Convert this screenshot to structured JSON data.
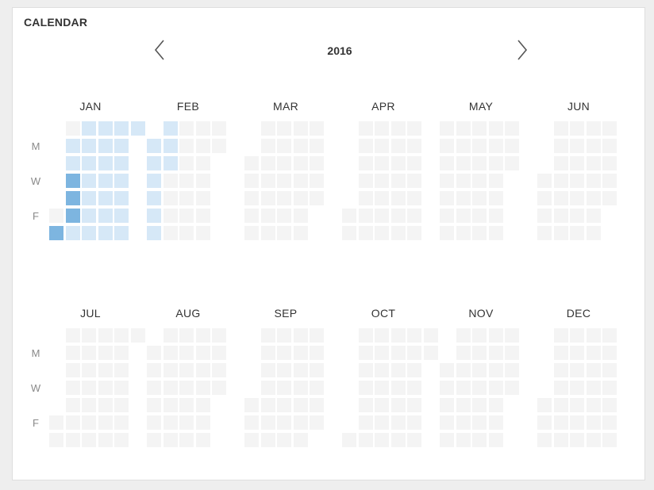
{
  "panel": {
    "title": "CALENDAR"
  },
  "navigation": {
    "year": "2016",
    "prev_icon": "chevron-left-icon",
    "next_icon": "chevron-right-icon"
  },
  "calendar": {
    "day_labels": [
      "M",
      "W",
      "F"
    ],
    "months": [
      "JAN",
      "FEB",
      "MAR",
      "APR",
      "MAY",
      "JUN",
      "JUL",
      "AUG",
      "SEP",
      "OCT",
      "NOV",
      "DEC"
    ],
    "activity": {
      "2016-01-04": 1,
      "2016-01-05": 1,
      "2016-01-06": 2,
      "2016-01-07": 2,
      "2016-01-08": 2,
      "2016-01-09": 1,
      "2016-01-10": 1,
      "2016-01-11": 1,
      "2016-01-12": 1,
      "2016-01-13": 1,
      "2016-01-14": 1,
      "2016-01-15": 1,
      "2016-01-16": 1,
      "2016-01-17": 1,
      "2016-01-18": 1,
      "2016-01-19": 1,
      "2016-01-20": 1,
      "2016-01-21": 1,
      "2016-01-22": 1,
      "2016-01-23": 1,
      "2016-01-24": 1,
      "2016-01-25": 1,
      "2016-01-26": 1,
      "2016-01-27": 1,
      "2016-01-28": 1,
      "2016-01-29": 1,
      "2016-01-30": 1,
      "2016-01-31": 1,
      "2016-01-02": 2,
      "2016-02-01": 1,
      "2016-02-02": 1,
      "2016-02-03": 1,
      "2016-02-04": 1,
      "2016-02-05": 1,
      "2016-02-06": 1,
      "2016-02-07": 1,
      "2016-02-08": 1,
      "2016-02-09": 1
    },
    "level_colors": {
      "none": "#f4f4f4",
      "light": "#d6e8f7",
      "dark": "#7db5e0"
    }
  }
}
